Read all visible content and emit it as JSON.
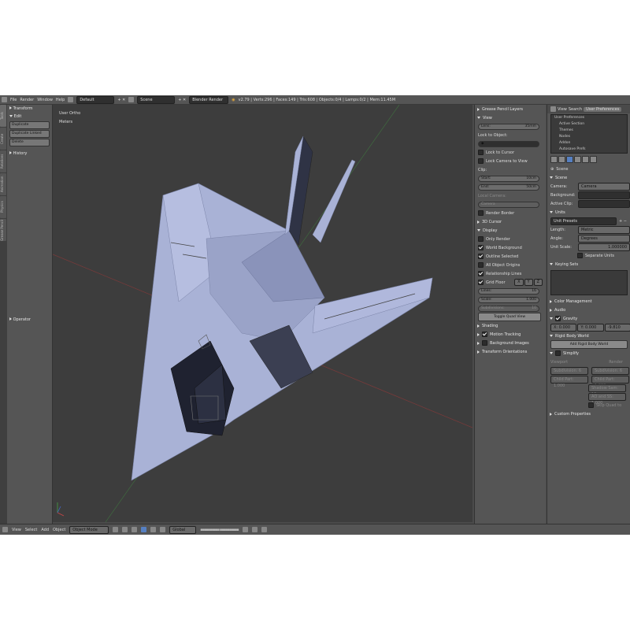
{
  "topbar": {
    "menus": [
      "File",
      "Render",
      "Window",
      "Help"
    ],
    "layout": "Default",
    "scene": "Scene",
    "engine": "Blender Render",
    "stats": "v2.79 | Verts:296 | Faces:149 | Tris:608 | Objects:0/4 | Lamps:0/2 | Mem:11.45M"
  },
  "tool_shelf": {
    "tabs": [
      "Tools",
      "Create",
      "Relations",
      "Animation",
      "Physics",
      "Grease Pencil"
    ],
    "transform": "Transform",
    "edit": "Edit",
    "buttons": [
      "Duplicate",
      "Duplicate Linked",
      "Delete"
    ],
    "history": "History",
    "operator": "Operator"
  },
  "viewport": {
    "view_name": "User Ortho",
    "units": "Meters",
    "colors": {
      "bg": "#3d3d3d",
      "mesh": "#a9b2d6",
      "mesh_dark": "#2a2d3a"
    }
  },
  "bottombar": {
    "menus": [
      "View",
      "Select",
      "Add",
      "Object"
    ],
    "mode": "Object Mode",
    "orientation": "Global"
  },
  "npanel": {
    "grease": "Grease Pencil Layers",
    "view": "View",
    "lens_label": "Lens:",
    "lens_value": "35mm",
    "lock_object": "Lock to Object:",
    "lock_cursor": "Lock to Cursor",
    "lock_camera": "Lock Camera to View",
    "clip": "Clip:",
    "start_label": "Start:",
    "start_value": "10cm",
    "end_label": "End:",
    "end_value": "50cm",
    "local_camera": "Local Camera:",
    "camera": "Camera",
    "render_border": "Render Border",
    "cursor": "3D Cursor",
    "display": "Display",
    "only_render": "Only Render",
    "world_bg": "World Background",
    "outline": "Outline Selected",
    "all_origins": "All Object Origins",
    "relationship": "Relationship Lines",
    "grid_floor": "Grid Floor",
    "axes": [
      "X",
      "Y",
      "Z"
    ],
    "lines_label": "Lines:",
    "lines_value": "16",
    "scale_label": "Scale:",
    "scale_value": "1.000",
    "subdiv_label": "Subdivisions:",
    "subdiv_value": "10",
    "toggle_quad": "Toggle Quad View",
    "shading": "Shading",
    "motion": "Motion Tracking",
    "bg_images": "Background Images",
    "transform_orient": "Transform Orientations"
  },
  "props": {
    "tabs": [
      "View",
      "Search",
      "User Preferences"
    ],
    "outliner": [
      "User Preferences",
      "Active Section",
      "Themes",
      "Nodes",
      "Addon",
      "Autosave Prefs"
    ],
    "scene_name": "Scene",
    "scene_section": "Scene",
    "camera_label": "Camera:",
    "camera_value": "Camera",
    "background_label": "Background:",
    "active_clip_label": "Active Clip:",
    "units": "Units",
    "unit_presets": "Unit Presets",
    "length_label": "Length:",
    "length_value": "Metric",
    "angle_label": "Angle:",
    "angle_value": "Degrees",
    "unit_scale_label": "Unit Scale:",
    "unit_scale_value": "1.000000",
    "separate_units": "Separate Units",
    "keying_sets": "Keying Sets",
    "color_mgmt": "Color Management",
    "audio": "Audio",
    "gravity": "Gravity",
    "gx": "X: 0.000",
    "gy": "Y: 0.000",
    "gz": "-9.810",
    "rigid": "Rigid Body World",
    "add_rigid": "Add Rigid Body World",
    "simplify": "Simplify",
    "viewport_label": "Viewport",
    "render_label": "Render",
    "subdiv_v": "Subdivision: 6",
    "child_v": "Child Part: 1.000",
    "subdiv_r": "Subdivision: 6",
    "child_r": "Child Part: 1.000",
    "shadow": "Shadow Sam: 16",
    "ao_subsurf": "AO and SS: 1.000",
    "skip_quad": "Skip Quad to",
    "custom_props": "Custom Properties"
  }
}
